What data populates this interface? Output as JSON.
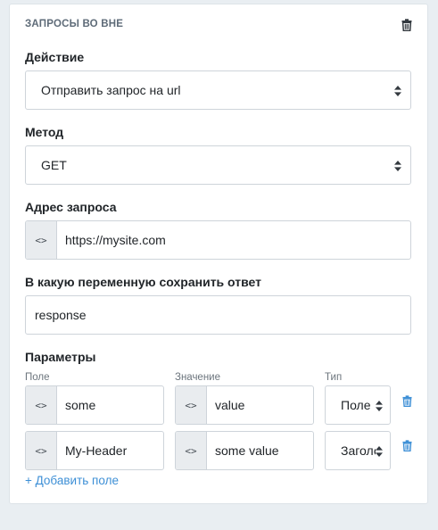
{
  "card": {
    "title": "ЗАПРОСЫ ВО ВНЕ",
    "delete_icon": "trash-icon"
  },
  "action": {
    "label": "Действие",
    "value": "Отправить запрос на url"
  },
  "method": {
    "label": "Метод",
    "value": "GET"
  },
  "url": {
    "label": "Адрес запроса",
    "prefix": "<>",
    "value": "https://mysite.com"
  },
  "save_var": {
    "label": "В какую переменную сохранить ответ",
    "value": "response"
  },
  "params": {
    "label": "Параметры",
    "col_field": "Поле",
    "col_value": "Значение",
    "col_type": "Тип",
    "rows": [
      {
        "field": "some",
        "value": "value",
        "type": "Поле"
      },
      {
        "field": "My-Header",
        "value": "some value",
        "type": "Заголовок"
      }
    ],
    "add_label": "+ Добавить поле"
  },
  "colors": {
    "accent": "#3d8fd6",
    "page_bg": "#e9eef2",
    "border": "#ced4da"
  }
}
